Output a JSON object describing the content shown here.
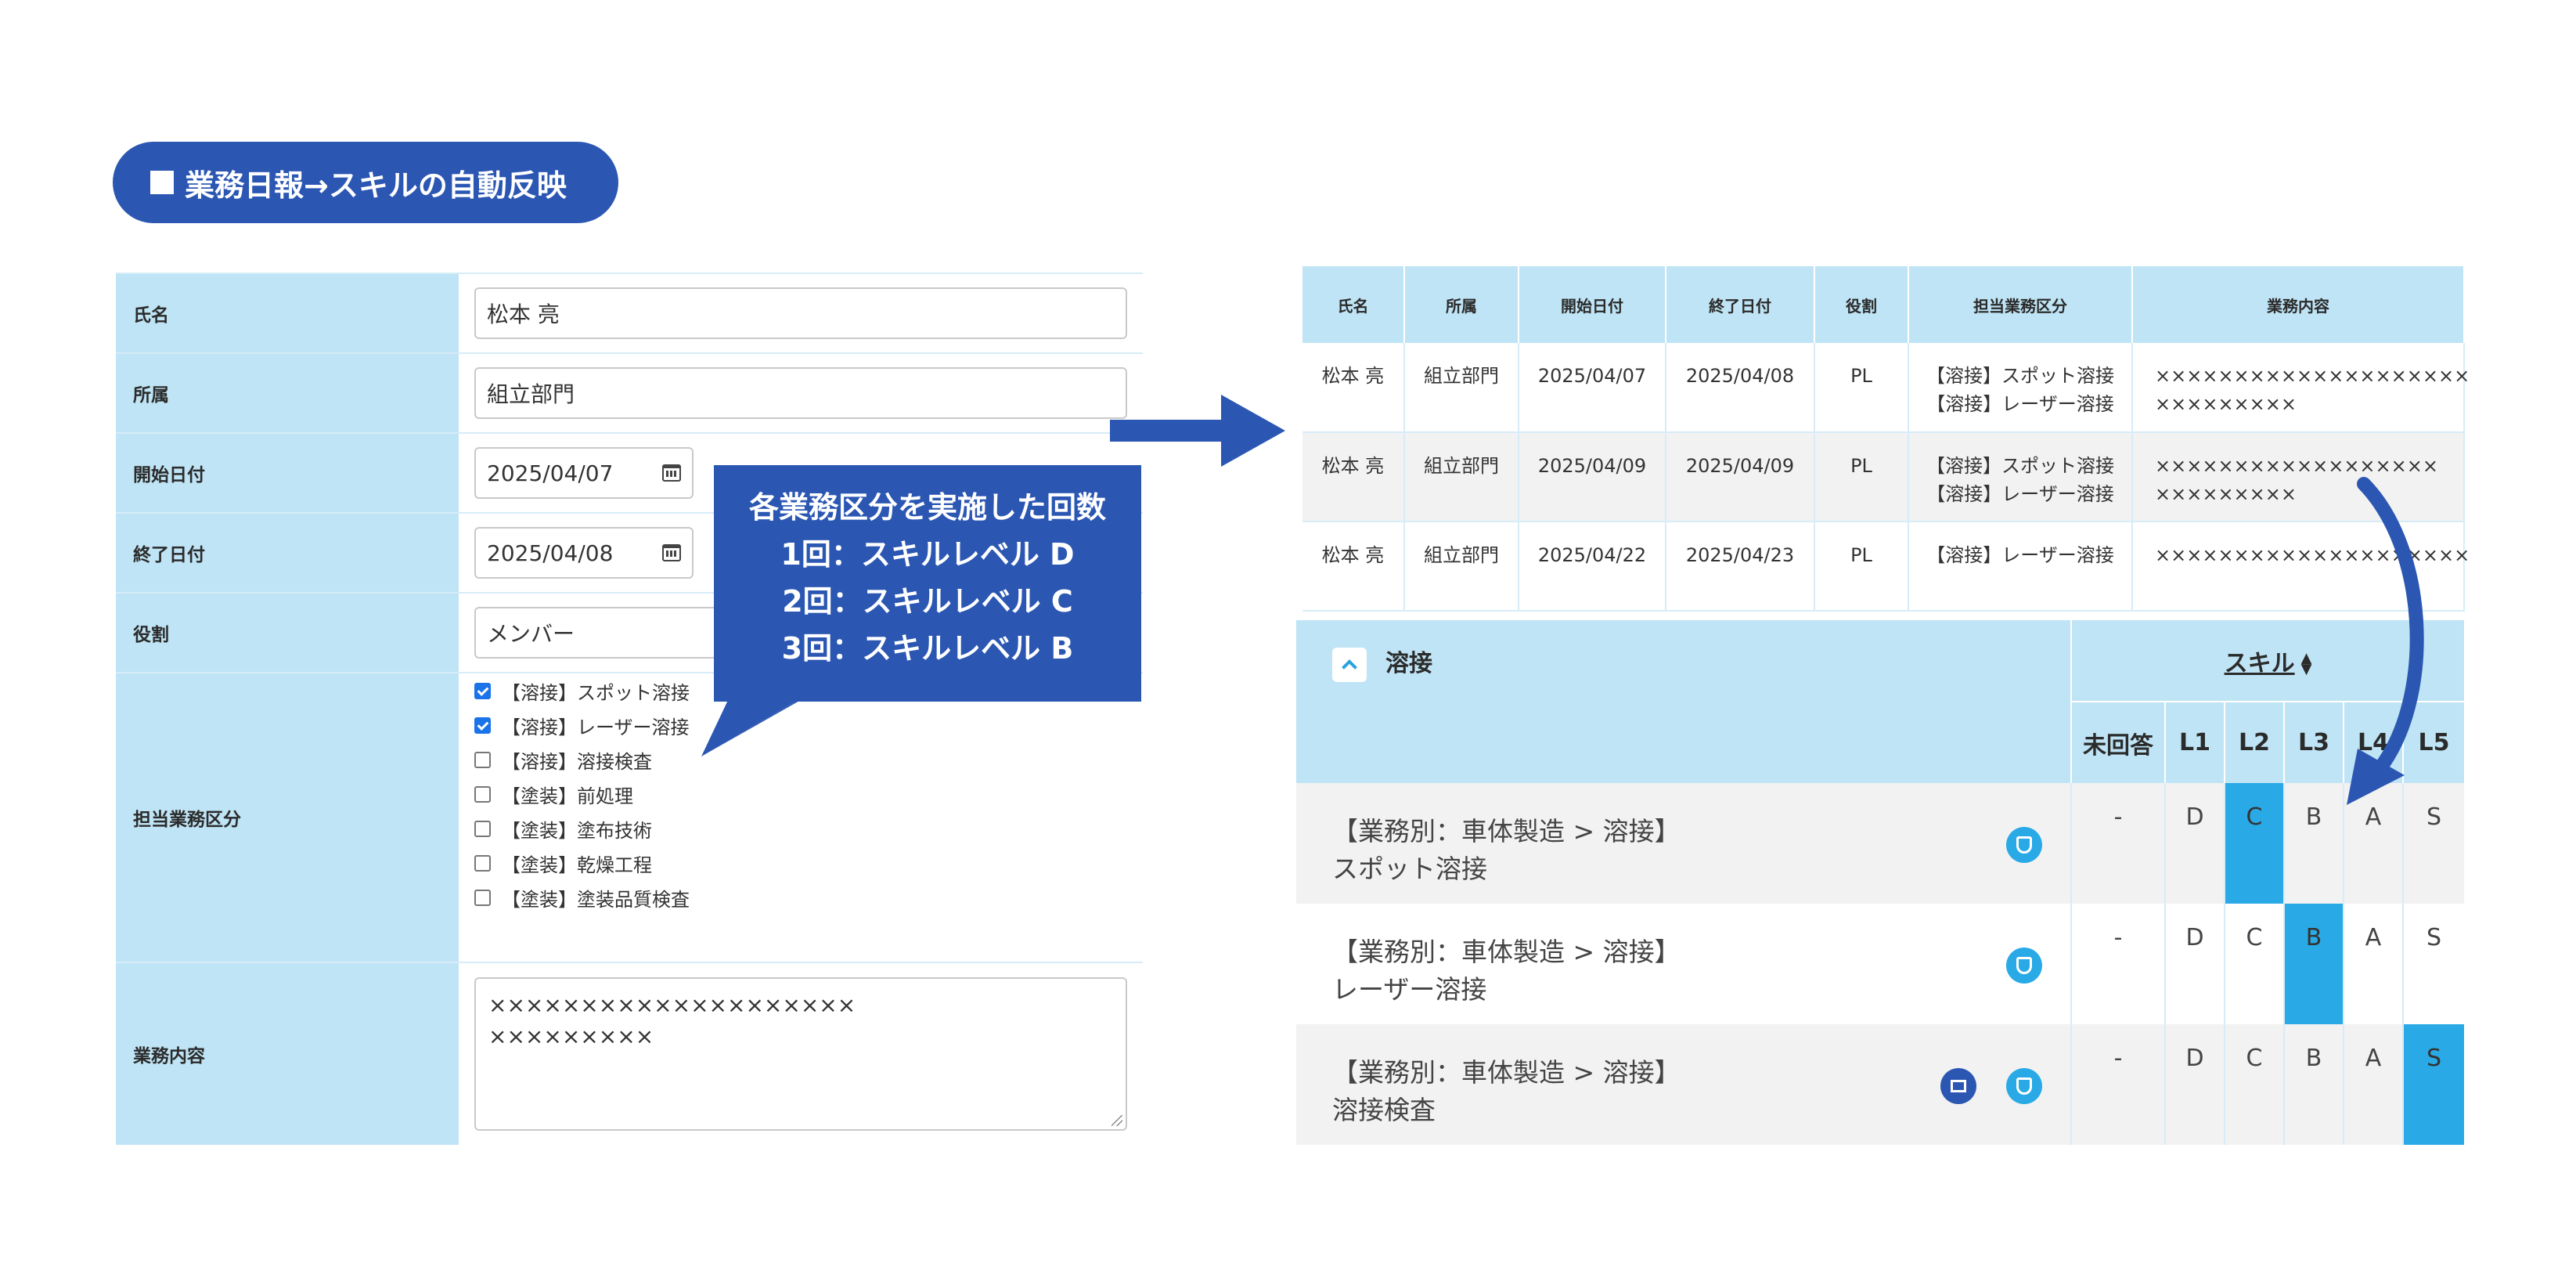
{
  "title": "業務日報→スキルの自動反映",
  "form": {
    "labels": {
      "name": "氏名",
      "dept": "所属",
      "start": "開始日付",
      "end": "終了日付",
      "role": "役割",
      "tasks": "担当業務区分",
      "content": "業務内容"
    },
    "name": "松本 亮",
    "dept": "組立部門",
    "start": "2025/04/07",
    "end": "2025/04/08",
    "role": "メンバー",
    "tasks": [
      {
        "label": "【溶接】スポット溶接",
        "checked": true
      },
      {
        "label": "【溶接】レーザー溶接",
        "checked": true
      },
      {
        "label": "【溶接】溶接検査",
        "checked": false
      },
      {
        "label": "【塗装】前処理",
        "checked": false
      },
      {
        "label": "【塗装】塗布技術",
        "checked": false
      },
      {
        "label": "【塗装】乾燥工程",
        "checked": false
      },
      {
        "label": "【塗装】塗装品質検査",
        "checked": false
      }
    ],
    "content_line1": "××××××××××××××××××××",
    "content_line2": "×××××××××"
  },
  "callout": {
    "line1": "各業務区分を実施した回数",
    "line2": "1回：スキルレベル D",
    "line3": "2回：スキルレベル C",
    "line4": "3回：スキルレベル B"
  },
  "reports": {
    "headers": [
      "氏名",
      "所属",
      "開始日付",
      "終了日付",
      "役割",
      "担当業務区分",
      "業務内容"
    ],
    "rows": [
      {
        "name": "松本 亮",
        "dept": "組立部門",
        "start": "2025/04/07",
        "end": "2025/04/08",
        "role": "PL",
        "task1": "【溶接】スポット溶接",
        "task2": "【溶接】レーザー溶接",
        "content1": "××××××××××××××××××××",
        "content2": "×××××××××"
      },
      {
        "name": "松本 亮",
        "dept": "組立部門",
        "start": "2025/04/09",
        "end": "2025/04/09",
        "role": "PL",
        "task1": "【溶接】スポット溶接",
        "task2": "【溶接】レーザー溶接",
        "content1": "××××××××××××××××××",
        "content2": "×××××××××"
      },
      {
        "name": "松本 亮",
        "dept": "組立部門",
        "start": "2025/04/22",
        "end": "2025/04/23",
        "role": "PL",
        "task1": "【溶接】レーザー溶接",
        "task2": "",
        "content1": "××××××××××××××××××××",
        "content2": ""
      }
    ]
  },
  "skills": {
    "category": "溶接",
    "skill_header": "スキル",
    "levels": [
      "未回答",
      "L1",
      "L2",
      "L3",
      "L4",
      "L5"
    ],
    "rows": [
      {
        "path": "【業務別：車体製造 > 溶接】",
        "name": "スポット溶接",
        "grades": [
          "-",
          "D",
          "C",
          "B",
          "A",
          "S"
        ],
        "selected": 2,
        "icons": [
          "shield-icon"
        ]
      },
      {
        "path": "【業務別：車体製造 > 溶接】",
        "name": "レーザー溶接",
        "grades": [
          "-",
          "D",
          "C",
          "B",
          "A",
          "S"
        ],
        "selected": 3,
        "icons": [
          "shield-icon"
        ]
      },
      {
        "path": "【業務別：車体製造 > 溶接】",
        "name": "溶接検査",
        "grades": [
          "-",
          "D",
          "C",
          "B",
          "A",
          "S"
        ],
        "selected": 5,
        "icons": [
          "board-icon",
          "shield-icon"
        ]
      }
    ]
  },
  "colors": {
    "primary": "#2b57b3",
    "header": "#bfe4f5",
    "highlight": "#29aae6"
  }
}
